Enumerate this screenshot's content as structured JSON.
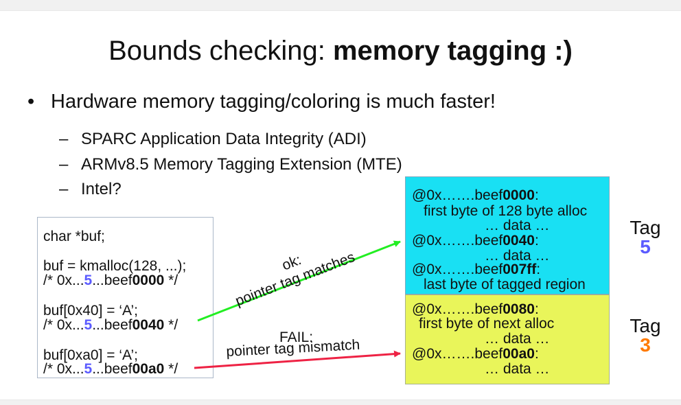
{
  "title": {
    "regular": "Bounds checking: ",
    "bold": "memory tagging :)"
  },
  "bullet": {
    "marker": "•",
    "text": "Hardware memory tagging/coloring is much faster!"
  },
  "sub_bullets": [
    {
      "marker": "–",
      "text": "SPARC Application Data Integrity (ADI)"
    },
    {
      "marker": "–",
      "text": "ARMv8.5 Memory Tagging Extension (MTE)"
    },
    {
      "marker": "–",
      "text": "Intel?"
    }
  ],
  "code": {
    "line1": "char *buf;",
    "line2": "buf = kmalloc(128, ...);",
    "line3_pre": "/* 0x...",
    "line3_tag": "5",
    "line3_mid": "...beef",
    "line3_bold": "0000",
    "line3_post": " */",
    "line4": "buf[0x40] = ‘A’;",
    "line5_pre": "/* 0x...",
    "line5_tag": "5",
    "line5_mid": "...beef",
    "line5_bold": "0040",
    "line5_post": " */",
    "line6": "buf[0xa0] = ‘A’;",
    "line7_pre": "/* 0x...",
    "line7_tag": "5",
    "line7_mid": "...beef",
    "line7_bold": "00a0",
    "line7_post": " */"
  },
  "arrows": {
    "ok_line1": "ok:",
    "ok_line2": "pointer tag matches",
    "fail_line1": "FAIL:",
    "fail_line2": "pointer tag mismatch",
    "ok_color": "#22ee22",
    "fail_color": "#ee2244"
  },
  "memory": {
    "cyan": {
      "color": "#19e0f3",
      "a1_pre": "@0x…….beef",
      "a1_bold": "0000",
      "a1_post": ":",
      "a1_desc": "first byte of 128 byte alloc",
      "d1": "… data …",
      "a2_pre": "@0x…….beef",
      "a2_bold": "0040",
      "a2_post": ":",
      "d2": "… data …",
      "a3_pre": "@0x…….beef",
      "a3_bold": "007ff",
      "a3_post": ":",
      "a3_desc": "last byte of tagged region"
    },
    "yellow": {
      "color": "#e9f55a",
      "a1_pre": "@0x…….beef",
      "a1_bold": "0080",
      "a1_post": ":",
      "a1_desc": "first byte of next alloc",
      "d1": "… data …",
      "a2_pre": "@0x…….beef",
      "a2_bold": "00a0",
      "a2_post": ":",
      "d2": "… data …"
    }
  },
  "tags": [
    {
      "label": "Tag",
      "value": "5",
      "color": "#5b5bff"
    },
    {
      "label": "Tag",
      "value": "3",
      "color": "#ff7a00"
    }
  ]
}
